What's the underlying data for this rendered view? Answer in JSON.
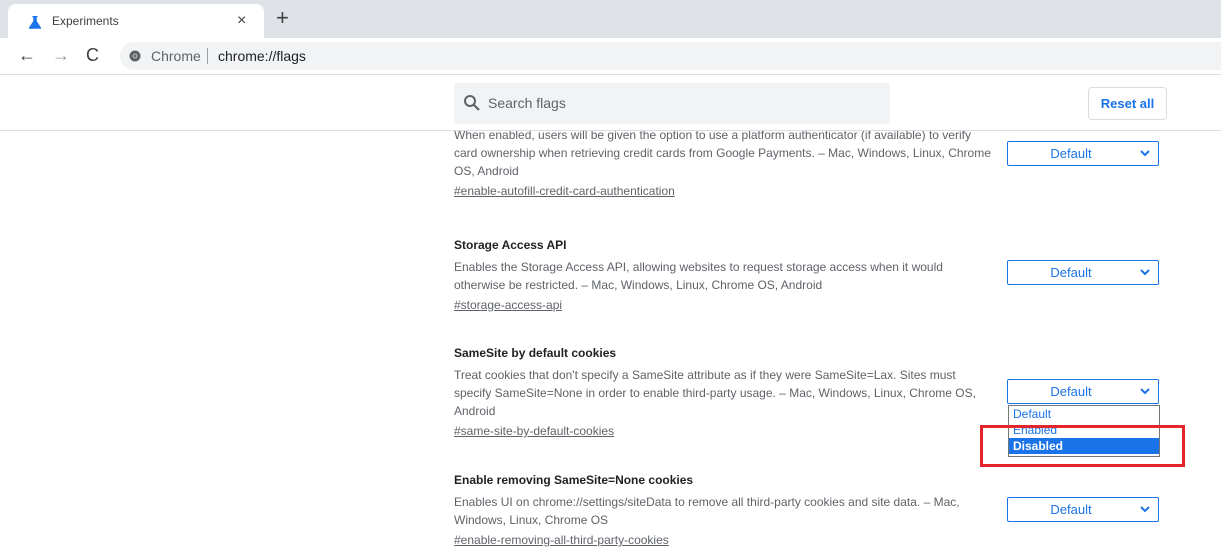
{
  "browser": {
    "tab_title": "Experiments",
    "close_symbol": "×",
    "newtab_symbol": "+",
    "back_symbol": "←",
    "forward_symbol": "→",
    "reload_symbol": "C",
    "site_label": "Chrome",
    "url": "chrome://flags"
  },
  "header": {
    "search_placeholder": "Search flags",
    "reset_label": "Reset all"
  },
  "experiments": [
    {
      "title": "",
      "description": "When enabled, users will be given the option to use a platform authenticator (if available) to verify card ownership when retrieving credit cards from Google Payments. – Mac, Windows, Linux, Chrome OS, Android",
      "link": "#enable-autofill-credit-card-authentication",
      "value": "Default"
    },
    {
      "title": "Storage Access API",
      "description": "Enables the Storage Access API, allowing websites to request storage access when it would otherwise be restricted. – Mac, Windows, Linux, Chrome OS, Android",
      "link": "#storage-access-api",
      "value": "Default"
    },
    {
      "title": "SameSite by default cookies",
      "description": "Treat cookies that don't specify a SameSite attribute as if they were SameSite=Lax. Sites must specify SameSite=None in order to enable third-party usage. – Mac, Windows, Linux, Chrome OS, Android",
      "link": "#same-site-by-default-cookies",
      "value": "Default"
    },
    {
      "title": "Enable removing SameSite=None cookies",
      "description": "Enables UI on chrome://settings/siteData to remove all third-party cookies and site data. – Mac, Windows, Linux, Chrome OS",
      "link": "#enable-removing-all-third-party-cookies",
      "value": "Default"
    }
  ],
  "dropdown": {
    "options": [
      "Default",
      "Enabled",
      "Disabled"
    ],
    "selected": "Disabled"
  },
  "colors": {
    "accent": "#1a73e8",
    "highlight": "#e3242b"
  }
}
